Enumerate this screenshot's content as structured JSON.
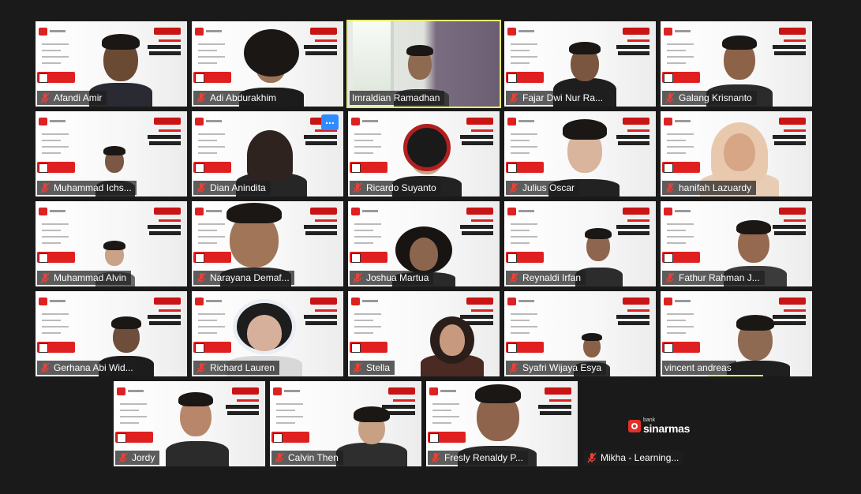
{
  "meeting": {
    "participants": [
      {
        "name": "Afandi Amir",
        "muted": true
      },
      {
        "name": "Adi Abdurakhim",
        "muted": true
      },
      {
        "name": "Imraldian Ramadhan",
        "muted": false,
        "active": true
      },
      {
        "name": "Fajar Dwi Nur Ra...",
        "muted": true
      },
      {
        "name": "Galang Krisnanto",
        "muted": true
      },
      {
        "name": "Muhammad Ichs...",
        "muted": true
      },
      {
        "name": "Dian Anindita",
        "muted": true,
        "more_button": "..."
      },
      {
        "name": "Ricardo Suyanto",
        "muted": true
      },
      {
        "name": "Julius Oscar",
        "muted": true
      },
      {
        "name": "hanifah Lazuardy",
        "muted": true
      },
      {
        "name": "Muhammad Alvin",
        "muted": true
      },
      {
        "name": "Narayana Demaf...",
        "muted": true
      },
      {
        "name": "Joshua Martua",
        "muted": true
      },
      {
        "name": "Reynaldi Irfan",
        "muted": true
      },
      {
        "name": "Fathur Rahman J...",
        "muted": true
      },
      {
        "name": "Gerhana Abi Wid...",
        "muted": true
      },
      {
        "name": "Richard Lauren",
        "muted": true
      },
      {
        "name": "Stella",
        "muted": true
      },
      {
        "name": "Syafri Wijaya Esya",
        "muted": true
      },
      {
        "name": "vincent andreas",
        "muted": true,
        "speaking": true
      },
      {
        "name": "Jordy",
        "muted": true
      },
      {
        "name": "Calvin Then",
        "muted": true
      },
      {
        "name": "Fresly Renaldy P...",
        "muted": true
      },
      {
        "name": "Mikha - Learning...",
        "muted": true,
        "video_off": true
      }
    ],
    "logo": {
      "small": "bank",
      "big": "sinarmas"
    },
    "colors": {
      "active_border": "#e6ea6e",
      "muted_mic": "#e5433a",
      "brand_red": "#e02020"
    }
  }
}
